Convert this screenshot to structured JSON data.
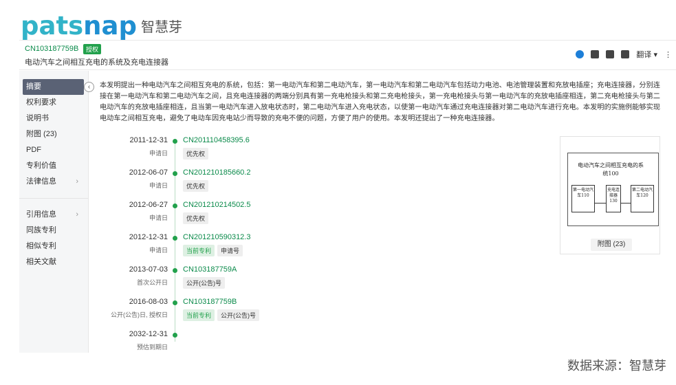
{
  "brand": {
    "logo_en_1": "pats",
    "logo_en_2": "nap",
    "logo_cn": "智慧芽"
  },
  "header": {
    "patent_number": "CN103187759B",
    "status_badge": "授权",
    "title": "电动汽车之间相互充电的系统及充电连接器"
  },
  "toolbar": {
    "translate_label": "翻译"
  },
  "sidebar": {
    "items": [
      {
        "label": "摘要"
      },
      {
        "label": "权利要求"
      },
      {
        "label": "说明书"
      },
      {
        "label": "附图 (23)"
      },
      {
        "label": "PDF"
      },
      {
        "label": "专利价值"
      },
      {
        "label": "法律信息"
      },
      {
        "label": "引用信息"
      },
      {
        "label": "同族专利"
      },
      {
        "label": "相似专利"
      },
      {
        "label": "相关文献"
      }
    ]
  },
  "abstract": "本发明提出一种电动汽车之间相互充电的系统，包括：第一电动汽车和第二电动汽车，第一电动汽车和第二电动汽车包括动力电池、电池管理装置和充放电插座；充电连接器，分别连接在第一电动汽车和第二电动汽车之间，且充电连接器的两端分别具有第一充电枪接头和第二充电枪接头，第一充电枪接头与第一电动汽车的充放电插座相连，第二充电枪接头与第二电动汽车的充放电插座相连，且当第一电动汽车进入放电状态时，第二电动汽车进入充电状态，以使第一电动汽车通过充电连接器对第二电动汽车进行充电。本发明的实施例能够实现电动车之间相互充电，避免了电动车因充电站少而导致的充电不便的问题，方便了用户的使用。本发明还提出了一种充电连接器。",
  "timeline": [
    {
      "date": "2011-12-31",
      "sub": "申请日",
      "pn": "CN201110458395.6",
      "tags": [
        {
          "label": "优先权",
          "green": false
        }
      ]
    },
    {
      "date": "2012-06-07",
      "sub": "申请日",
      "pn": "CN201210185660.2",
      "tags": [
        {
          "label": "优先权",
          "green": false
        }
      ]
    },
    {
      "date": "2012-06-27",
      "sub": "申请日",
      "pn": "CN201210214502.5",
      "tags": [
        {
          "label": "优先权",
          "green": false
        }
      ]
    },
    {
      "date": "2012-12-31",
      "sub": "申请日",
      "pn": "CN201210590312.3",
      "tags": [
        {
          "label": "当前专利",
          "green": true
        },
        {
          "label": "申请号",
          "green": false
        }
      ]
    },
    {
      "date": "2013-07-03",
      "sub": "首次公开日",
      "pn": "CN103187759A",
      "tags": [
        {
          "label": "公开(公告)号",
          "green": false
        }
      ]
    },
    {
      "date": "2016-08-03",
      "sub": "公开(公告)日, 授权日",
      "pn": "CN103187759B",
      "tags": [
        {
          "label": "当前专利",
          "green": true
        },
        {
          "label": "公开(公告)号",
          "green": false
        }
      ]
    },
    {
      "date": "2032-12-31",
      "sub": "预估到期日",
      "pn": "",
      "tags": []
    }
  ],
  "figure": {
    "title_line1": "电动汽车之间相互充电的系",
    "title_line2": "统100",
    "box1": "第一电动汽车110",
    "box2": "充电连接器130",
    "box3": "第二电动汽车120",
    "button_label": "附图 (23)"
  },
  "source": "数据来源：智慧芽",
  "colors": {
    "brand_teal": "#32b3c8",
    "brand_blue": "#1f8fd1",
    "green": "#22a14c",
    "menu_active": "#5a6275"
  }
}
